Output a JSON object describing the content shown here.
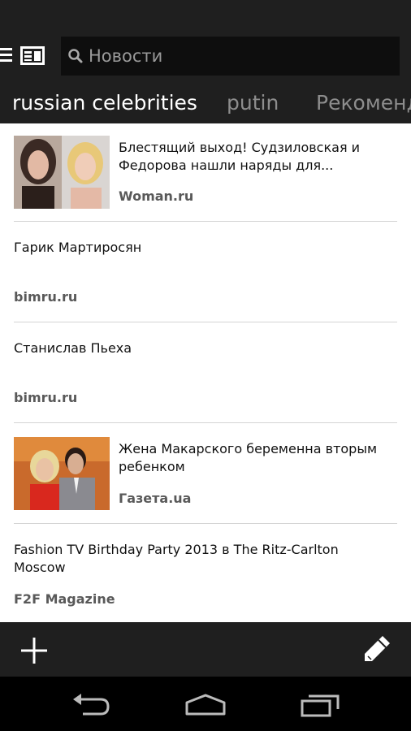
{
  "search": {
    "placeholder": "Новости"
  },
  "tabs": [
    {
      "label": "russian celebrities",
      "active": true
    },
    {
      "label": "putin",
      "active": false
    },
    {
      "label": "Рекоменд",
      "active": false
    }
  ],
  "articles": [
    {
      "title_line1": "Блестящий выход! Судзиловская и",
      "title_line2": "Федорова нашли наряды для...",
      "source": "Woman.ru",
      "has_image": true
    },
    {
      "title_line1": "Гарик Мартиросян",
      "title_line2": "",
      "source": "bimru.ru",
      "has_image": false
    },
    {
      "title_line1": "Станислав Пьеха",
      "title_line2": "",
      "source": "bimru.ru",
      "has_image": false
    },
    {
      "title_line1": "Жена Макарского беременна вторым",
      "title_line2": "ребенком",
      "source": "Газета.ua",
      "has_image": true
    },
    {
      "title_line1": "Fashion TV Birthday Party 2013 в The Ritz-Carlton",
      "title_line2": "Moscow",
      "source": "F2F Magazine",
      "has_image": false
    }
  ],
  "icons": {
    "menu": "menu-icon",
    "news": "newspaper-icon",
    "search": "search-icon",
    "add": "plus-icon",
    "edit": "pencil-icon",
    "back": "back-arrow-icon",
    "home": "home-icon",
    "recents": "recents-icon"
  },
  "colors": {
    "bar": "#1f1f1f",
    "search_bg": "#0e0e0e",
    "active_tab": "#ffffff",
    "inactive_tab": "#8d8d8d"
  }
}
